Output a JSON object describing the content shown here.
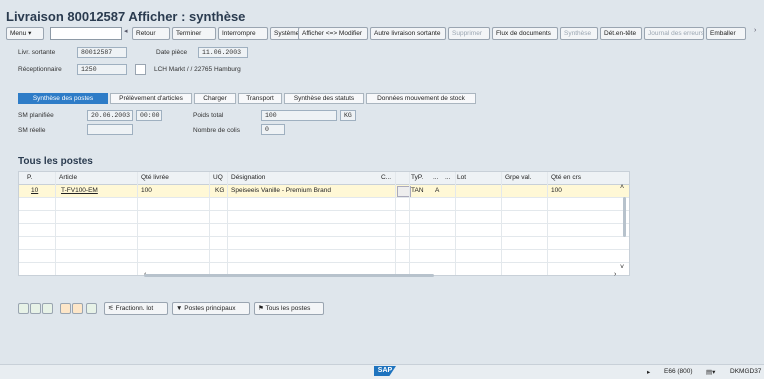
{
  "title": "Livraison 80012587 Afficher : synthèse",
  "toolbar": {
    "menu": "Menu",
    "back": "Retour",
    "finish": "Terminer",
    "interrupt": "Interrompre",
    "system": "Système",
    "display_modify": "Afficher <=> Modifier",
    "other_delivery": "Autre livraison sortante",
    "delete": "Supprimer",
    "doc_flow": "Flux de documents",
    "synthesis": "Synthèse",
    "header_detail": "Dét.en-tête",
    "error_log": "Journal des erreurs",
    "pack": "Emballer"
  },
  "header": {
    "delivery_label": "Livr. sortante",
    "delivery_value": "80012587",
    "doc_date_label": "Date pièce",
    "doc_date_value": "11.06.2003",
    "recipient_label": "Réceptionnaire",
    "recipient_value": "1250",
    "recipient_name": "LCH Markt / / 22765 Hamburg"
  },
  "tabs": [
    {
      "label": "Synthèse des postes"
    },
    {
      "label": "Prélèvement d'articles"
    },
    {
      "label": "Charger"
    },
    {
      "label": "Transport"
    },
    {
      "label": "Synthèse des statuts"
    },
    {
      "label": "Données mouvement de stock"
    }
  ],
  "details": {
    "sm_planned_label": "SM planifiée",
    "sm_planned_date": "20.06.2003",
    "sm_planned_time": "00:00",
    "sm_actual_label": "SM réelle",
    "total_weight_label": "Poids total",
    "total_weight_value": "100",
    "weight_unit": "KG",
    "packages_label": "Nombre de colis",
    "packages_value": "0"
  },
  "section_title": "Tous les postes",
  "table": {
    "columns": [
      "P.",
      "Article",
      "Qté livrée",
      "UQ",
      "Désignation",
      "C...",
      "TyP.",
      "...",
      "...",
      "Lot",
      "Grpe val.",
      "Qté en crs"
    ],
    "rows": [
      {
        "item": "10",
        "material": "T-FV100-EM",
        "qty": "100",
        "uom": "KG",
        "desc": "Speiseeis Vanille - Premium Brand",
        "c": "",
        "type": "TAN",
        "a": "A",
        "lot": "",
        "val": "",
        "open": "100"
      }
    ]
  },
  "bottom": {
    "batch_split": "Fractionn. lot",
    "main_items": "Postes principaux",
    "all_items": "Tous les postes"
  },
  "status": {
    "system": "E66 (800)",
    "server": "DKMGD37"
  },
  "logo_text": "SAP"
}
